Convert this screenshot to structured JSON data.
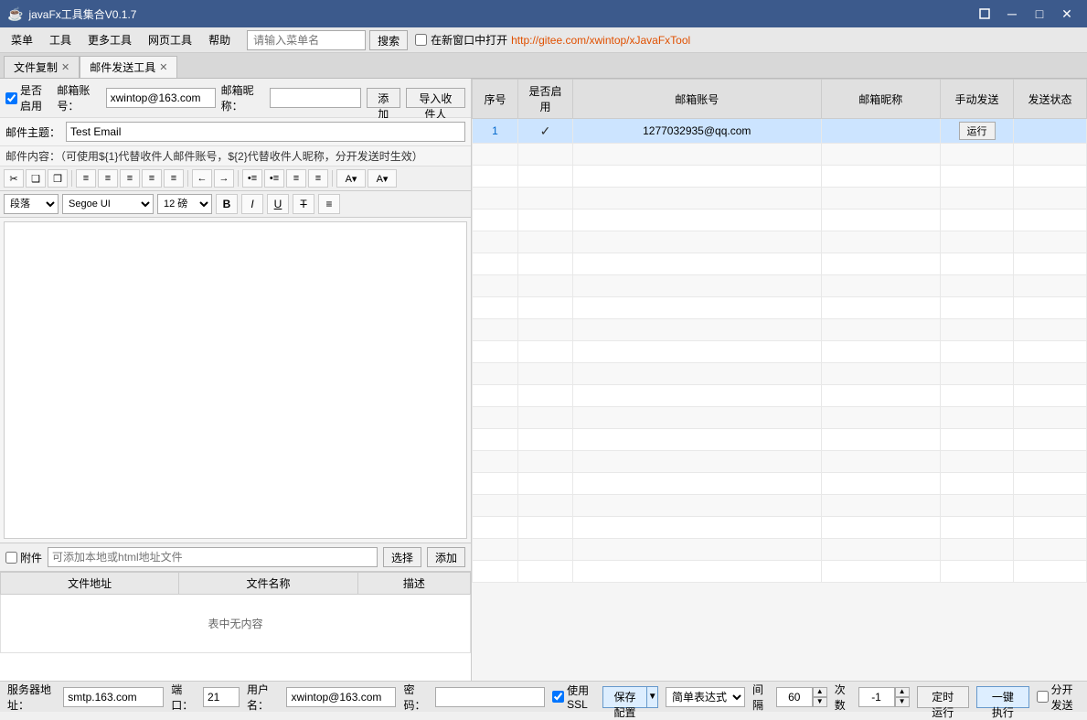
{
  "titleBar": {
    "icon": "☕",
    "title": "javaFx工具集合V0.1.7",
    "minimize": "─",
    "maximize": "□",
    "close": "✕"
  },
  "menuBar": {
    "items": [
      "菜单",
      "工具",
      "更多工具",
      "网页工具",
      "帮助"
    ],
    "searchPlaceholder": "请输入菜单名",
    "searchBtn": "搜索",
    "newWindowLabel": "在新窗口中打开",
    "link": "http://gitee.com/xwintop/xJavaFxTool"
  },
  "tabs": [
    {
      "label": "文件复制",
      "closable": true
    },
    {
      "label": "邮件发送工具",
      "closable": true,
      "active": true
    }
  ],
  "emailConfig": {
    "enableLabel": "是否启用",
    "accountLabel": "邮箱账号：",
    "accountValue": "xwintop@163.com",
    "nicknameLabel": "邮箱昵称：",
    "nicknameValue": "",
    "addBtn": "添加",
    "importBtn": "导入收件人"
  },
  "subjectRow": {
    "label": "邮件主题：",
    "value": "Test Email"
  },
  "contentHint": "邮件内容：（可使用${1}代替收件人邮件账号，${2}代替收件人昵称，分开发送时生效）",
  "editorToolbar": {
    "buttons": [
      "✂",
      "❑",
      "❒",
      "≡",
      "≡",
      "≡",
      "≡",
      "≡",
      "←",
      "→",
      "•≡",
      "•≡",
      "≡",
      "≡",
      "A▼",
      "A▼"
    ]
  },
  "formatToolbar": {
    "paraOptions": [
      "段落"
    ],
    "fontOptions": [
      "Segoe UI"
    ],
    "sizeOptions": [
      "12 磅"
    ],
    "boldLabel": "B",
    "italicLabel": "I",
    "underlineLabel": "U",
    "strikeLabel": "T̶",
    "centerLabel": "≡"
  },
  "attachment": {
    "checkLabel": "附件",
    "pathPlaceholder": "可添加本地或html地址文件",
    "selectBtn": "选择",
    "addBtn": "添加"
  },
  "fileTable": {
    "columns": [
      "文件地址",
      "文件名称",
      "描述"
    ],
    "emptyText": "表中无内容"
  },
  "recipientsTable": {
    "columns": [
      "序号",
      "是否启用",
      "邮箱账号",
      "邮箱昵称",
      "手动发送",
      "发送状态"
    ],
    "rows": [
      {
        "id": "1",
        "enabled": true,
        "account": "1277032935@qq.com",
        "nickname": "",
        "runBtn": "运行",
        "status": ""
      }
    ],
    "emptyRows": 18
  },
  "bottomBar": {
    "serverLabel": "服务器地址：",
    "serverValue": "smtp.163.com",
    "portLabel": "端口：",
    "portValue": "21",
    "userLabel": "用户名：",
    "userValue": "xwintop@163.com",
    "passLabel": "密码：",
    "passValue": "",
    "sslLabel": "使用SSL",
    "saveBtn": "保存配置",
    "saveBtnArrow": "▼",
    "modeOptions": [
      "简单表达式"
    ],
    "intervalLabel": "间隔",
    "intervalValue": "60",
    "countLabel": "次数",
    "countValue": "-1",
    "timerBtn": "定时运行",
    "oneKeyBtn": "一键执行",
    "splitBtn": "分开发送"
  }
}
